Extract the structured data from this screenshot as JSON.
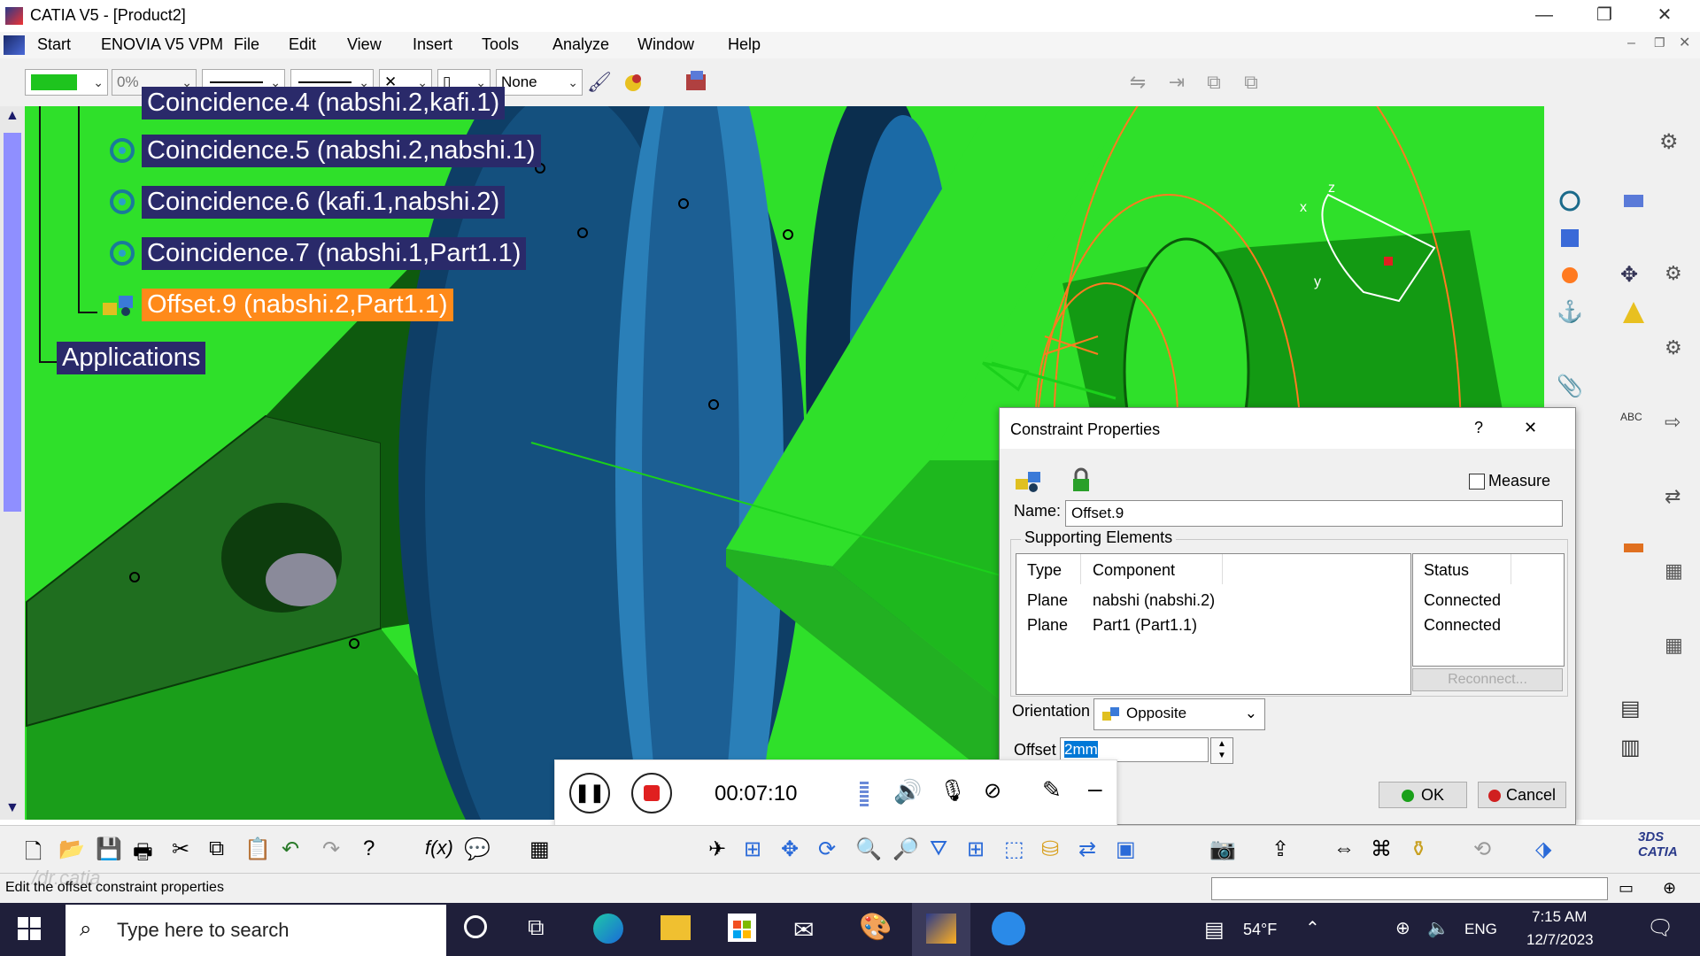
{
  "window": {
    "title": "CATIA V5 - [Product2]",
    "controls": [
      "—",
      "❐",
      "✕"
    ]
  },
  "menu": {
    "items": [
      "Start",
      "ENOVIA V5 VPM",
      "File",
      "Edit",
      "View",
      "Insert",
      "Tools",
      "Analyze",
      "Window",
      "Help"
    ]
  },
  "toolbar": {
    "color_value": "#1ec41e",
    "transparency": "0%",
    "linetype_value": "None"
  },
  "tree": {
    "partial_item": "Coincidence.4 (nabshi.2,kafi.1)",
    "items": [
      {
        "label": "Coincidence.5 (nabshi.2,nabshi.1)",
        "selected": false
      },
      {
        "label": "Coincidence.6 (kafi.1,nabshi.2)",
        "selected": false
      },
      {
        "label": "Coincidence.7 (nabshi.1,Part1.1)",
        "selected": false
      },
      {
        "label": "Offset.9 (nabshi.2,Part1.1)",
        "selected": true
      }
    ],
    "applications": "Applications"
  },
  "axis": {
    "x": "x",
    "y": "y",
    "z": "z"
  },
  "dialog": {
    "title": "Constraint Properties",
    "help": "?",
    "close": "✕",
    "measure_label": "Measure",
    "measure_checked": false,
    "name_label": "Name:",
    "name_value": "Offset.9",
    "supporting_label": "Supporting Elements",
    "columns": {
      "type": "Type",
      "component": "Component",
      "status": "Status"
    },
    "rows": [
      {
        "type": "Plane",
        "component": "nabshi (nabshi.2)",
        "status": "Connected"
      },
      {
        "type": "Plane",
        "component": "Part1 (Part1.1)",
        "status": "Connected"
      }
    ],
    "reconnect_label": "Reconnect...",
    "orientation_label": "Orientation",
    "orientation_value": "Opposite",
    "offset_label": "Offset",
    "offset_value": "2mm",
    "ok_label": "OK",
    "cancel_label": "Cancel"
  },
  "recorder": {
    "time": "00:07:10"
  },
  "status": {
    "text": "Edit the offset constraint properties",
    "watermark": "/dr.catia"
  },
  "taskbar": {
    "search_placeholder": "Type here to search",
    "weather": "54°F",
    "language": "ENG",
    "time": "7:15 AM",
    "date": "12/7/2023"
  },
  "colors": {
    "viewport": "#2fe02a",
    "tree_bg": "#2a2a6a",
    "selected": "#ff8a1a",
    "accent": "#0078d7"
  }
}
